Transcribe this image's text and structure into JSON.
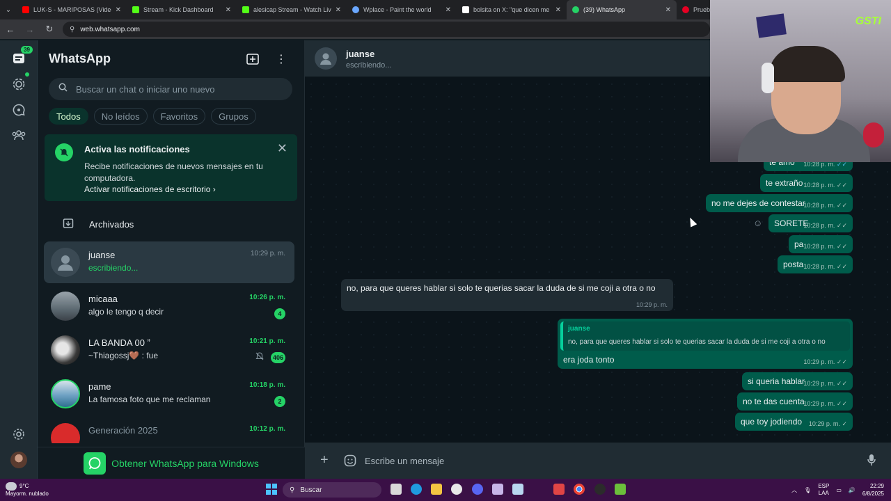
{
  "browser": {
    "tabs": [
      {
        "title": "LUK-S - MARIPOSAS (Video Of",
        "color": "#ff0000"
      },
      {
        "title": "Stream - Kick Dashboard",
        "color": "#53fc18"
      },
      {
        "title": "alesicap Stream - Watch Live o",
        "color": "#53fc18"
      },
      {
        "title": "Wplace - Paint the world",
        "color": "#6aa7ff"
      },
      {
        "title": "bolsita on X: \"que dicen me sac",
        "color": "#ffffff"
      },
      {
        "title": "(39) WhatsApp",
        "color": "#25d366"
      },
      {
        "title": "Prueba",
        "color": "#e60023"
      }
    ],
    "url": "web.whatsapp.com"
  },
  "rail": {
    "chats_badge": "39",
    "icons": [
      "chats-icon",
      "status-icon",
      "channels-icon",
      "communities-icon",
      "settings-icon"
    ]
  },
  "sidebar": {
    "title": "WhatsApp",
    "search_placeholder": "Buscar un chat o iniciar uno nuevo",
    "filters": [
      "Todos",
      "No leídos",
      "Favoritos",
      "Grupos"
    ],
    "notification": {
      "title": "Activa las notificaciones",
      "body": "Recibe notificaciones de nuevos mensajes en tu computadora.",
      "link": "Activar notificaciones de escritorio"
    },
    "archived_label": "Archivados",
    "chats": [
      {
        "name": "juanse",
        "time": "10:29 p. m.",
        "preview": "escribiendo...",
        "count": "",
        "muted": false
      },
      {
        "name": "micaaa",
        "time": "10:26 p. m.",
        "preview": "algo le tengo q decir",
        "count": "4",
        "muted": false
      },
      {
        "name": "LA BANDA 00 ˮ",
        "time": "10:21 p. m.",
        "preview": "~Thiagossj🤎 : fue",
        "count": "406",
        "muted": true
      },
      {
        "name": "pame",
        "time": "10:18 p. m.",
        "preview": "La famosa foto que me reclaman",
        "count": "2",
        "muted": false
      },
      {
        "name": "Generación 2025",
        "time": "10:12 p. m.",
        "preview": "",
        "count": "",
        "muted": false
      }
    ],
    "get_app": "Obtener WhatsApp para Windows"
  },
  "conversation": {
    "contact": "juanse",
    "status": "escribiendo...",
    "messages": [
      {
        "text": "te amo",
        "time": "10:28 p. m."
      },
      {
        "text": "te extraño",
        "time": "10:28 p. m."
      },
      {
        "text": "no me dejes de contestar",
        "time": "10:28 p. m."
      },
      {
        "text": "SORETE",
        "time": "10:28 p. m."
      },
      {
        "text": "pa",
        "time": "10:28 p. m."
      },
      {
        "text": "posta",
        "time": "10:28 p. m."
      },
      {
        "text": "no, para que queres hablar si solo te querias sacar la duda de si me coji a otra o no",
        "time": "10:29 p. m."
      },
      {
        "quote_name": "juanse",
        "quote_text": "no, para que queres hablar si solo te querias sacar la duda de si me coji a otra o no",
        "text": "era joda tonto",
        "time": "10:29 p. m."
      },
      {
        "text": "si queria hablar",
        "time": "10:29 p. m."
      },
      {
        "text": "no te das cuenta",
        "time": "10:29 p. m."
      },
      {
        "text": "que toy jodiendo",
        "time": "10:29 p. m."
      }
    ],
    "composer_placeholder": "Escribe un mensaje"
  },
  "stream_overlay": {
    "logo": "GSTI"
  },
  "taskbar": {
    "weather_temp": "9°C",
    "weather_desc": "Mayorm. nublado",
    "search": "Buscar",
    "lang1": "ESP",
    "lang2": "LAA",
    "time": "22:29",
    "date": "6/8/2025"
  },
  "colors": {
    "accent": "#25d366",
    "outgoing": "#005c4b",
    "incoming": "#202c33",
    "background": "#0b141a"
  }
}
